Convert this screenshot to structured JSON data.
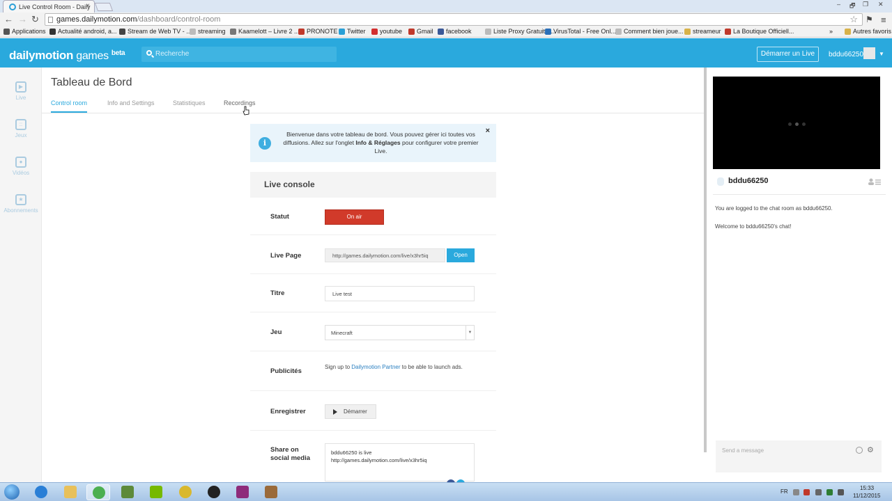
{
  "browser": {
    "tab_title": "Live Control Room - Daily",
    "tab_close": "×",
    "window_controls": [
      "‒",
      "❐",
      "✕"
    ],
    "url_host": "games.dailymotion.com",
    "url_path": "/dashboard/control-room",
    "bookmarks": [
      {
        "label": "Applications",
        "color": "#555555"
      },
      {
        "label": "Actualité android, a...",
        "color": "#333333"
      },
      {
        "label": "Stream de Web TV - ...",
        "color": "#444444"
      },
      {
        "label": "streaming",
        "color": "#bbbbbb"
      },
      {
        "label": "Kaamelott – Livre 2 ...",
        "color": "#777777"
      },
      {
        "label": "PRONOTE",
        "color": "#c0392b"
      },
      {
        "label": "Twitter",
        "color": "#2a9fd6"
      },
      {
        "label": "youtube",
        "color": "#d32f2f"
      },
      {
        "label": "Gmail",
        "color": "#c0392b"
      },
      {
        "label": "facebook",
        "color": "#3b5998"
      },
      {
        "label": "Liste Proxy Gratuit - ...",
        "color": "#bbbbbb"
      },
      {
        "label": "VirusTotal - Free Onl...",
        "color": "#2a6fb8"
      },
      {
        "label": "Comment bien joue...",
        "color": "#bbbbbb"
      },
      {
        "label": "streameur",
        "color": "#d8b24a"
      },
      {
        "label": "La Boutique Officiell...",
        "color": "#c0392b"
      }
    ],
    "bookmarks_overflow": "»",
    "other_bookmarks": "Autres favoris"
  },
  "header": {
    "logo_main": "dailymotion",
    "logo_games": " games ",
    "logo_beta": "beta",
    "search_placeholder": "Recherche",
    "start_live": "Démarrer un Live",
    "username": "bddu66250"
  },
  "sidebar": {
    "items": [
      {
        "label": "Live",
        "glyph": "▶"
      },
      {
        "label": "Jeux",
        "glyph": "::"
      },
      {
        "label": "Vidéos",
        "glyph": "●"
      },
      {
        "label": "Abonnements",
        "glyph": "★"
      }
    ]
  },
  "main": {
    "title": "Tableau de Bord",
    "tabs": [
      {
        "label": "Control room",
        "active": true
      },
      {
        "label": "Info and Settings",
        "active": false
      },
      {
        "label": "Statistiques",
        "active": false
      },
      {
        "label": "Recordings",
        "active": false
      }
    ],
    "notice": {
      "text_1": "Bienvenue dans votre tableau de bord. Vous pouvez gérer ici toutes vos diffusions. Allez sur l'onglet ",
      "text_bold": "Info & Réglages",
      "text_2": " pour configurer votre premier Live.",
      "close": "×",
      "info_glyph": "i"
    },
    "console": {
      "title": "Live console",
      "statut_label": "Statut",
      "onair_label": "On air",
      "livepage_label": "Live Page",
      "live_url": "http://games.dailymotion.com/live/x3hr5iq",
      "open_label": "Open",
      "titre_label": "Titre",
      "titre_value": "Live test",
      "jeu_label": "Jeu",
      "jeu_value": "Minecraft",
      "pub_label": "Publicités",
      "pub_text_1": "Sign up to ",
      "pub_link": "Dailymotion Partner",
      "pub_text_2": " to be able to launch ads.",
      "enreg_label": "Enregistrer",
      "enreg_btn": "Démarrer",
      "share_label_1": "Share on",
      "share_label_2": "social media",
      "share_line_1": "bddu66250 is live",
      "share_line_2": "http://games.dailymotion.com/live/x3hr5iq"
    }
  },
  "chat": {
    "username": "bddu66250",
    "messages": [
      "You are logged to the chat room as bddu66250.",
      "Welcome to bddu66250's chat!"
    ],
    "input_placeholder": "Send a message"
  },
  "taskbar": {
    "lang": "FR",
    "time": "15:33",
    "date": "11/12/2015",
    "apps": [
      {
        "name": "internet-explorer",
        "color": "#2a7fd6"
      },
      {
        "name": "explorer",
        "color": "#e8c05a"
      },
      {
        "name": "chrome",
        "color": "#4caf50"
      },
      {
        "name": "minecraft",
        "color": "#5d8a3a"
      },
      {
        "name": "nvidia",
        "color": "#76b900"
      },
      {
        "name": "app-yellow",
        "color": "#d9b82e"
      },
      {
        "name": "obs",
        "color": "#222222"
      },
      {
        "name": "winrar",
        "color": "#8e2b7a"
      },
      {
        "name": "minecraft-launcher",
        "color": "#9a6a3a"
      }
    ]
  },
  "colors": {
    "accent": "#2aa9dd",
    "onair": "#d13a2a"
  }
}
